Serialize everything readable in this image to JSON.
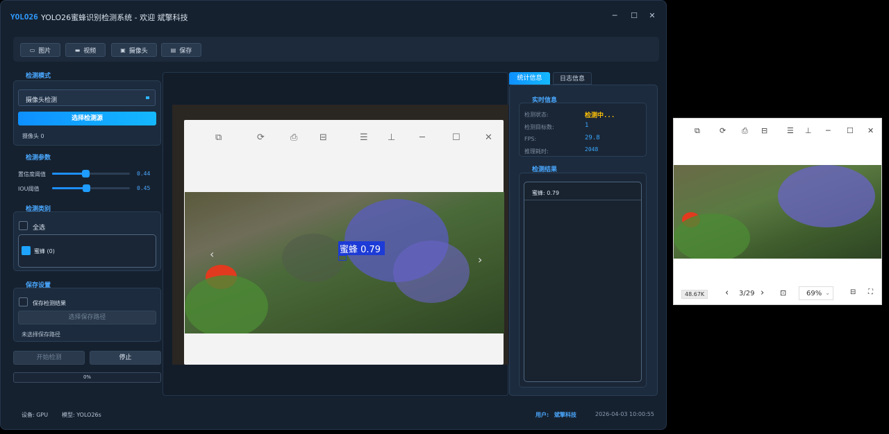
{
  "window": {
    "logo": "YOLO26",
    "title": "YOLO26蜜蜂识别检测系统 - 欢迎 斌擎科技",
    "minimize": "─",
    "maximize": "☐",
    "close": "✕"
  },
  "toolbar": {
    "image_label": "图片",
    "video_label": "视频",
    "camera_label": "摄像头",
    "save_label": "保存"
  },
  "left": {
    "mode_title": "检测模式",
    "mode_value": "摄像头检测",
    "select_source": "选择检测源",
    "source_info": "摄像头 0",
    "params_title": "检测参数",
    "conf_label": "置信度阈值",
    "conf_value": "0.44",
    "conf_level": 0.44,
    "iou_label": "IOU阈值",
    "iou_value": "0.45",
    "iou_level": 0.45,
    "classes_title": "检测类别",
    "select_all": "全选",
    "class_item": "蜜蜂 (0)",
    "save_title": "保存设置",
    "save_results": "保存检测结果",
    "choose_path": "选择保存路径",
    "no_path": "未选择保存路径",
    "start_button": "开始检测",
    "stop_button": "停止",
    "progress": "0%"
  },
  "center": {
    "detection_label": "蜜蜂 0.79",
    "nav_prev": "‹",
    "nav_next": "›"
  },
  "right": {
    "tab_stats": "统计信息",
    "tab_log": "日志信息",
    "realtime_title": "实时信息",
    "status_label": "检测状态:",
    "status_value": "检测中...",
    "count_label": "检测目标数:",
    "count_value": "1",
    "fps_label": "FPS:",
    "fps_value": "29.8",
    "time_label": "推理耗时:",
    "time_value": "2048",
    "results_title": "检测结果",
    "result_item": "蜜蜂: 0.79"
  },
  "status": {
    "device": "设备: GPU",
    "model": "模型: YOLO26s",
    "user_label": "用户:",
    "user_value": "斌擎科技",
    "datetime": "2026-04-03 10:00:55"
  },
  "viewer2": {
    "file_size": "48.67K",
    "page": "3/29",
    "zoom": "69%"
  },
  "colors": {
    "accent": "#1e9cff",
    "status_active": "#ffc107",
    "detection_box": "#1d3bd6"
  }
}
